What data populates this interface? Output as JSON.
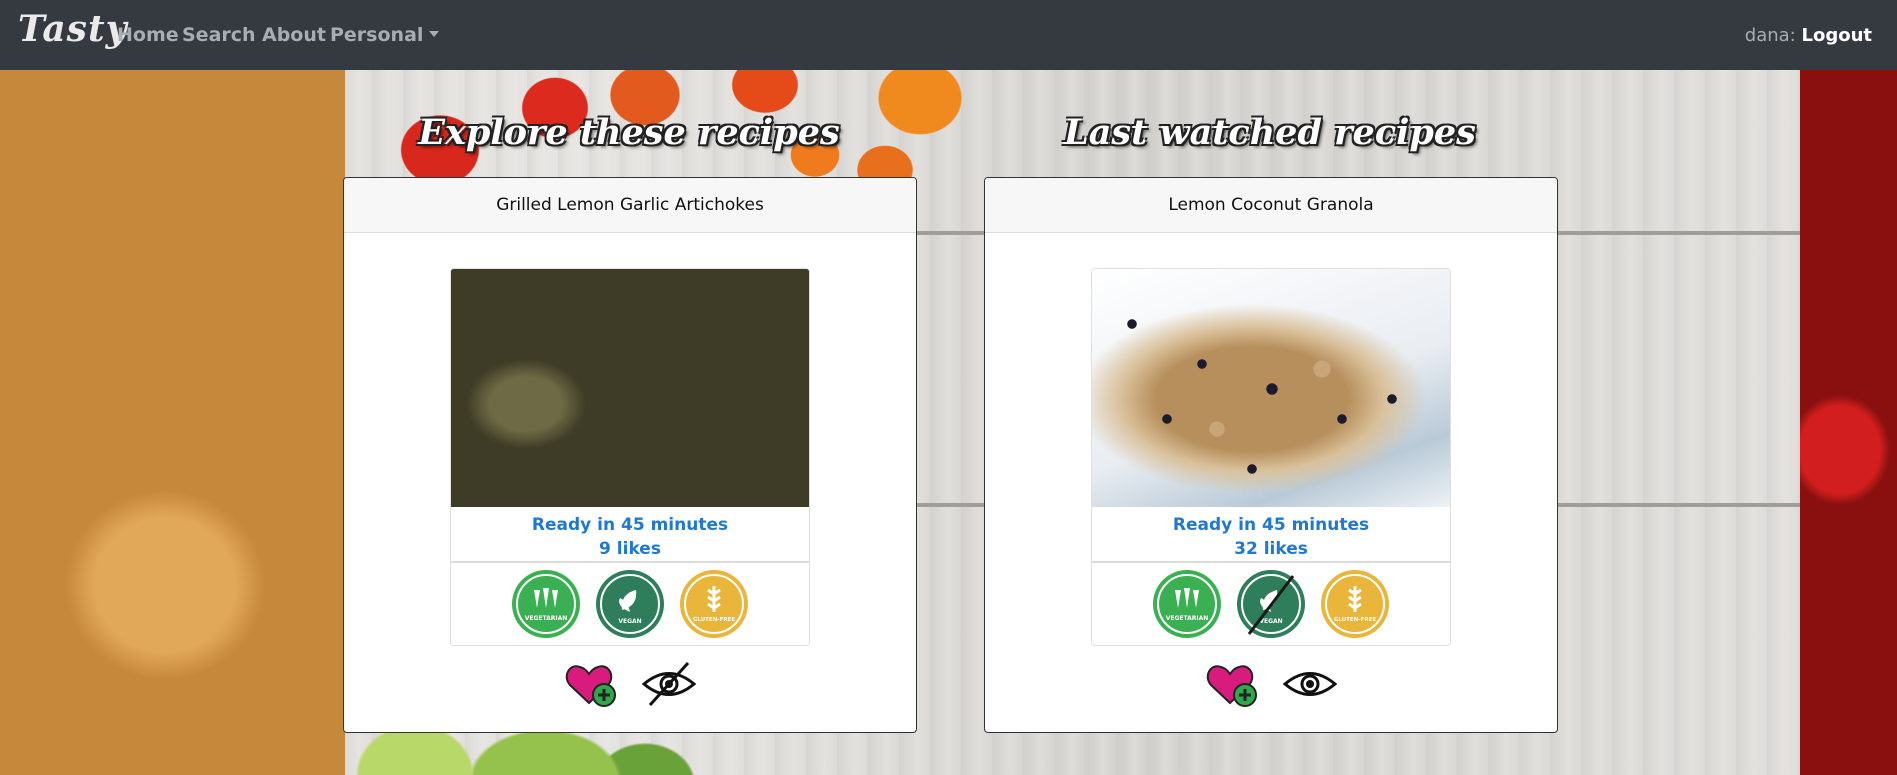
{
  "nav": {
    "brand": "Tasty",
    "home": "Home",
    "search": "Search",
    "about": "About",
    "personal": "Personal",
    "user_name": "dana:",
    "logout": "Logout"
  },
  "sections": {
    "explore_title": "Explore these recipes",
    "watched_title": "Last watched recipes"
  },
  "explore_card": {
    "title": "Grilled Lemon Garlic Artichokes",
    "ready": "Ready in 45 minutes",
    "likes": "9 likes",
    "badges": {
      "vegetarian": "VEGETARIAN",
      "vegan": "VEGAN",
      "gluten_free": "GLUTEN-FREE"
    },
    "vegan_crossed": false,
    "watched": false
  },
  "watched_card": {
    "title": "Lemon Coconut Granola",
    "ready": "Ready in 45 minutes",
    "likes": "32 likes",
    "badges": {
      "vegetarian": "VEGETARIAN",
      "vegan": "VEGAN",
      "gluten_free": "GLUTEN-FREE"
    },
    "vegan_crossed": true,
    "watched": true
  },
  "colors": {
    "navbar": "#343a40",
    "link_blue": "#1f78d1",
    "vegetarian_green": "#3bb052",
    "vegan_dark_green": "#2e7d5b",
    "gluten_free_gold": "#e9b53a",
    "heart_pink": "#d81b7c",
    "plus_green": "#2ea84a"
  },
  "icons": [
    "heart-plus-icon",
    "eye-icon",
    "eye-crossed-icon"
  ]
}
